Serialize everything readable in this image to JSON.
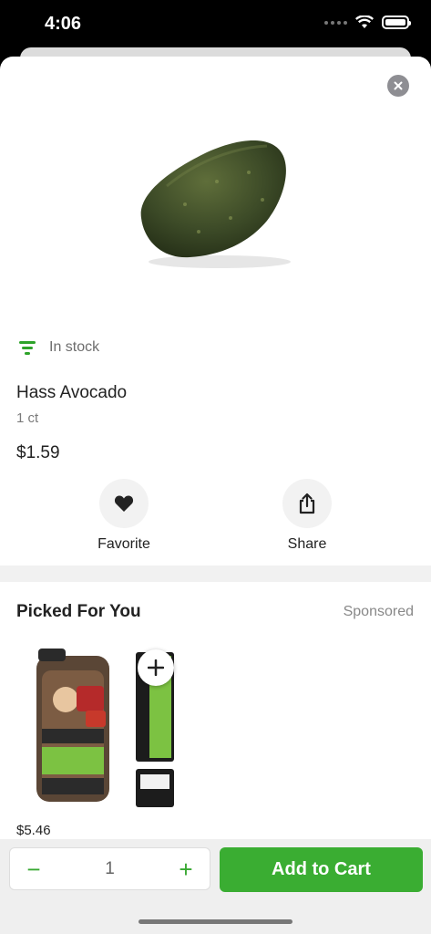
{
  "status_bar": {
    "time": "4:06"
  },
  "product": {
    "image_icon": "avocado-image",
    "stock_status": "In stock",
    "name": "Hass Avocado",
    "size": "1 ct",
    "price": "$1.59"
  },
  "actions": {
    "favorite_label": "Favorite",
    "share_label": "Share"
  },
  "recommendations": {
    "title": "Picked For You",
    "sponsored_label": "Sponsored",
    "items": [
      {
        "image_icon": "bread-package-image",
        "price": "$5.46"
      }
    ]
  },
  "cart": {
    "quantity": "1",
    "minus_label": "−",
    "plus_label": "+",
    "add_label": "Add to Cart"
  },
  "colors": {
    "accent": "#3aad32",
    "text": "#222222",
    "muted": "#7a7a7a"
  }
}
